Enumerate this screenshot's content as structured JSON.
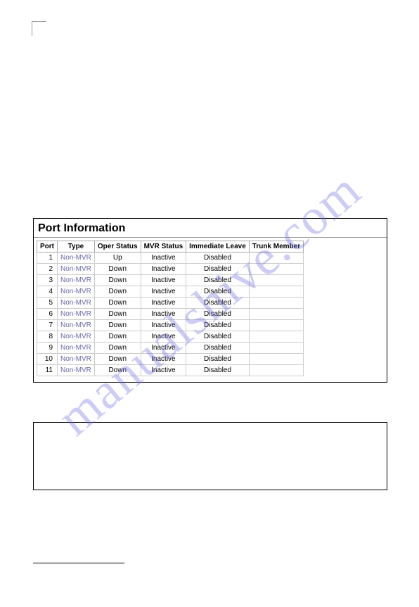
{
  "watermark": "manualshive.com",
  "panel": {
    "title": "Port Information",
    "columns": [
      "Port",
      "Type",
      "Oper Status",
      "MVR Status",
      "Immediate Leave",
      "Trunk Member"
    ],
    "rows": [
      {
        "port": "1",
        "type": "Non-MVR",
        "oper": "Up",
        "mvr": "Inactive",
        "leave": "Disabled",
        "trunk": ""
      },
      {
        "port": "2",
        "type": "Non-MVR",
        "oper": "Down",
        "mvr": "Inactive",
        "leave": "Disabled",
        "trunk": ""
      },
      {
        "port": "3",
        "type": "Non-MVR",
        "oper": "Down",
        "mvr": "Inactive",
        "leave": "Disabled",
        "trunk": ""
      },
      {
        "port": "4",
        "type": "Non-MVR",
        "oper": "Down",
        "mvr": "Inactive",
        "leave": "Disabled",
        "trunk": ""
      },
      {
        "port": "5",
        "type": "Non-MVR",
        "oper": "Down",
        "mvr": "Inactive",
        "leave": "Disabled",
        "trunk": ""
      },
      {
        "port": "6",
        "type": "Non-MVR",
        "oper": "Down",
        "mvr": "Inactive",
        "leave": "Disabled",
        "trunk": ""
      },
      {
        "port": "7",
        "type": "Non-MVR",
        "oper": "Down",
        "mvr": "Inactive",
        "leave": "Disabled",
        "trunk": ""
      },
      {
        "port": "8",
        "type": "Non-MVR",
        "oper": "Down",
        "mvr": "Inactive",
        "leave": "Disabled",
        "trunk": ""
      },
      {
        "port": "9",
        "type": "Non-MVR",
        "oper": "Down",
        "mvr": "Inactive",
        "leave": "Disabled",
        "trunk": ""
      },
      {
        "port": "10",
        "type": "Non-MVR",
        "oper": "Down",
        "mvr": "Inactive",
        "leave": "Disabled",
        "trunk": ""
      },
      {
        "port": "11",
        "type": "Non-MVR",
        "oper": "Down",
        "mvr": "Inactive",
        "leave": "Disabled",
        "trunk": ""
      }
    ]
  }
}
